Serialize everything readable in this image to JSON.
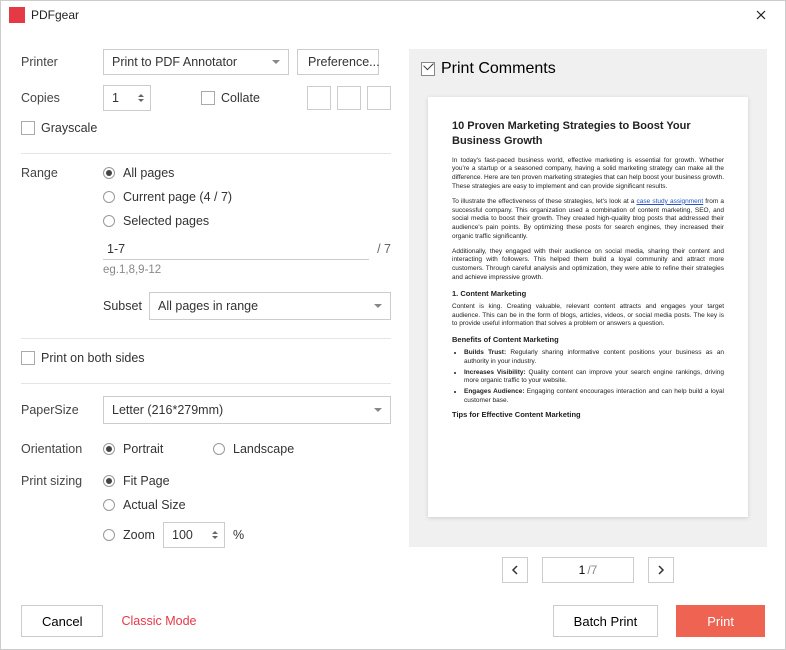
{
  "title": "PDFgear",
  "printer": {
    "label": "Printer",
    "value": "Print to PDF Annotator",
    "pref_btn": "Preference..."
  },
  "copies": {
    "label": "Copies",
    "value": "1",
    "collate": "Collate"
  },
  "grayscale": "Grayscale",
  "range": {
    "label": "Range",
    "all": "All pages",
    "current": "Current page (4 / 7)",
    "selected": "Selected pages",
    "pages_value": "1-7",
    "pages_total": "/ 7",
    "hint": "eg.1,8,9-12",
    "subset_label": "Subset",
    "subset_value": "All pages in range"
  },
  "both_sides": "Print on both sides",
  "paper": {
    "label": "PaperSize",
    "value": "Letter (216*279mm)"
  },
  "orient": {
    "label": "Orientation",
    "portrait": "Portrait",
    "landscape": "Landscape"
  },
  "sizing": {
    "label": "Print sizing",
    "fit": "Fit Page",
    "actual": "Actual Size",
    "zoom": "Zoom",
    "zoom_value": "100",
    "pct": "%"
  },
  "preview": {
    "comments": "Print Comments",
    "pager_current": "1",
    "pager_total": "/7"
  },
  "doc": {
    "title": "10 Proven Marketing Strategies to Boost Your Business Growth",
    "p1": "In today's fast-paced business world, effective marketing is essential for growth. Whether you're a startup or a seasoned company, having a solid marketing strategy can make all the difference. Here are ten proven marketing strategies that can help boost your business growth. These strategies are easy to implement and can provide significant results.",
    "p2a": "To illustrate the effectiveness of these strategies, let's look at a ",
    "p2link": "case study assignment",
    "p2b": " from a successful company. This organization used a combination of content marketing, SEO, and social media to boost their growth. They created high-quality blog posts that addressed their audience's pain points. By optimizing these posts for search engines, they increased their organic traffic significantly.",
    "p3": "Additionally, they engaged with their audience on social media, sharing their content and interacting with followers. This helped them build a loyal community and attract more customers. Through careful analysis and optimization, they were able to refine their strategies and achieve impressive growth.",
    "h2": "1. Content Marketing",
    "p4": "Content is king. Creating valuable, relevant content attracts and engages your target audience. This can be in the form of blogs, articles, videos, or social media posts. The key is to provide useful information that solves a problem or answers a question.",
    "h3a": "Benefits of Content Marketing",
    "li1a": "Builds Trust:",
    "li1b": " Regularly sharing informative content positions your business as an authority in your industry.",
    "li2a": "Increases Visibility:",
    "li2b": " Quality content can improve your search engine rankings, driving more organic traffic to your website.",
    "li3a": "Engages Audience:",
    "li3b": " Engaging content encourages interaction and can help build a loyal customer base.",
    "h3b": "Tips for Effective Content Marketing"
  },
  "footer": {
    "cancel": "Cancel",
    "classic": "Classic Mode",
    "batch": "Batch Print",
    "print": "Print"
  }
}
